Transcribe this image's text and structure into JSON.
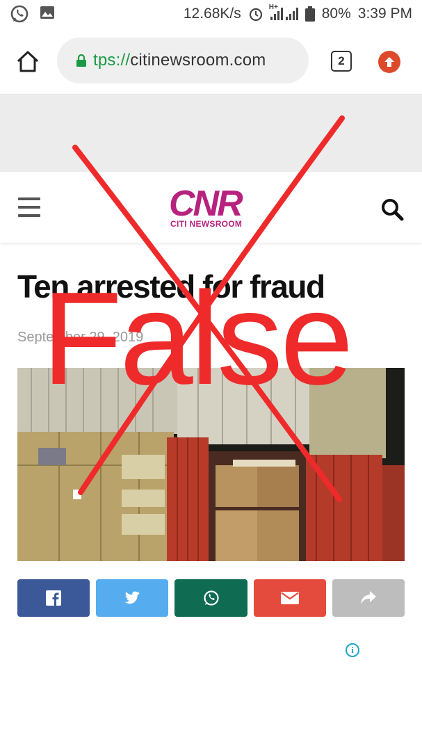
{
  "status_bar": {
    "net_speed": "12.68K/s",
    "network_type": "H+",
    "battery": "80%",
    "time": "3:39 PM",
    "icons": [
      "whatsapp-icon",
      "gallery-icon",
      "alarm-icon",
      "signal-icon",
      "battery-icon"
    ]
  },
  "browser": {
    "url_scheme": "tps://",
    "url_host": "citinewsroom.com",
    "tab_count": "2",
    "colors": {
      "lock": "#1a9a45",
      "update": "#dd4a2b"
    }
  },
  "site": {
    "logo_mark": "CNR",
    "logo_name": "CITI NEWSROOM",
    "brand_color": "#b7227f"
  },
  "article": {
    "headline": "Ten arrested for fraud",
    "date": "September 29, 2019"
  },
  "share": {
    "buttons": [
      {
        "name": "facebook",
        "color": "#3b5998",
        "icon": "facebook-icon"
      },
      {
        "name": "twitter",
        "color": "#55acee",
        "icon": "twitter-icon"
      },
      {
        "name": "whatsapp",
        "color": "#0f6b52",
        "icon": "whatsapp-icon"
      },
      {
        "name": "email",
        "color": "#e54b3c",
        "icon": "email-icon"
      },
      {
        "name": "share",
        "color": "#bdbdbd",
        "icon": "share-arrow-icon"
      }
    ]
  },
  "ad": {
    "info_glyph": "i"
  },
  "overlay": {
    "label": "False",
    "color": "#ef2a2a"
  }
}
